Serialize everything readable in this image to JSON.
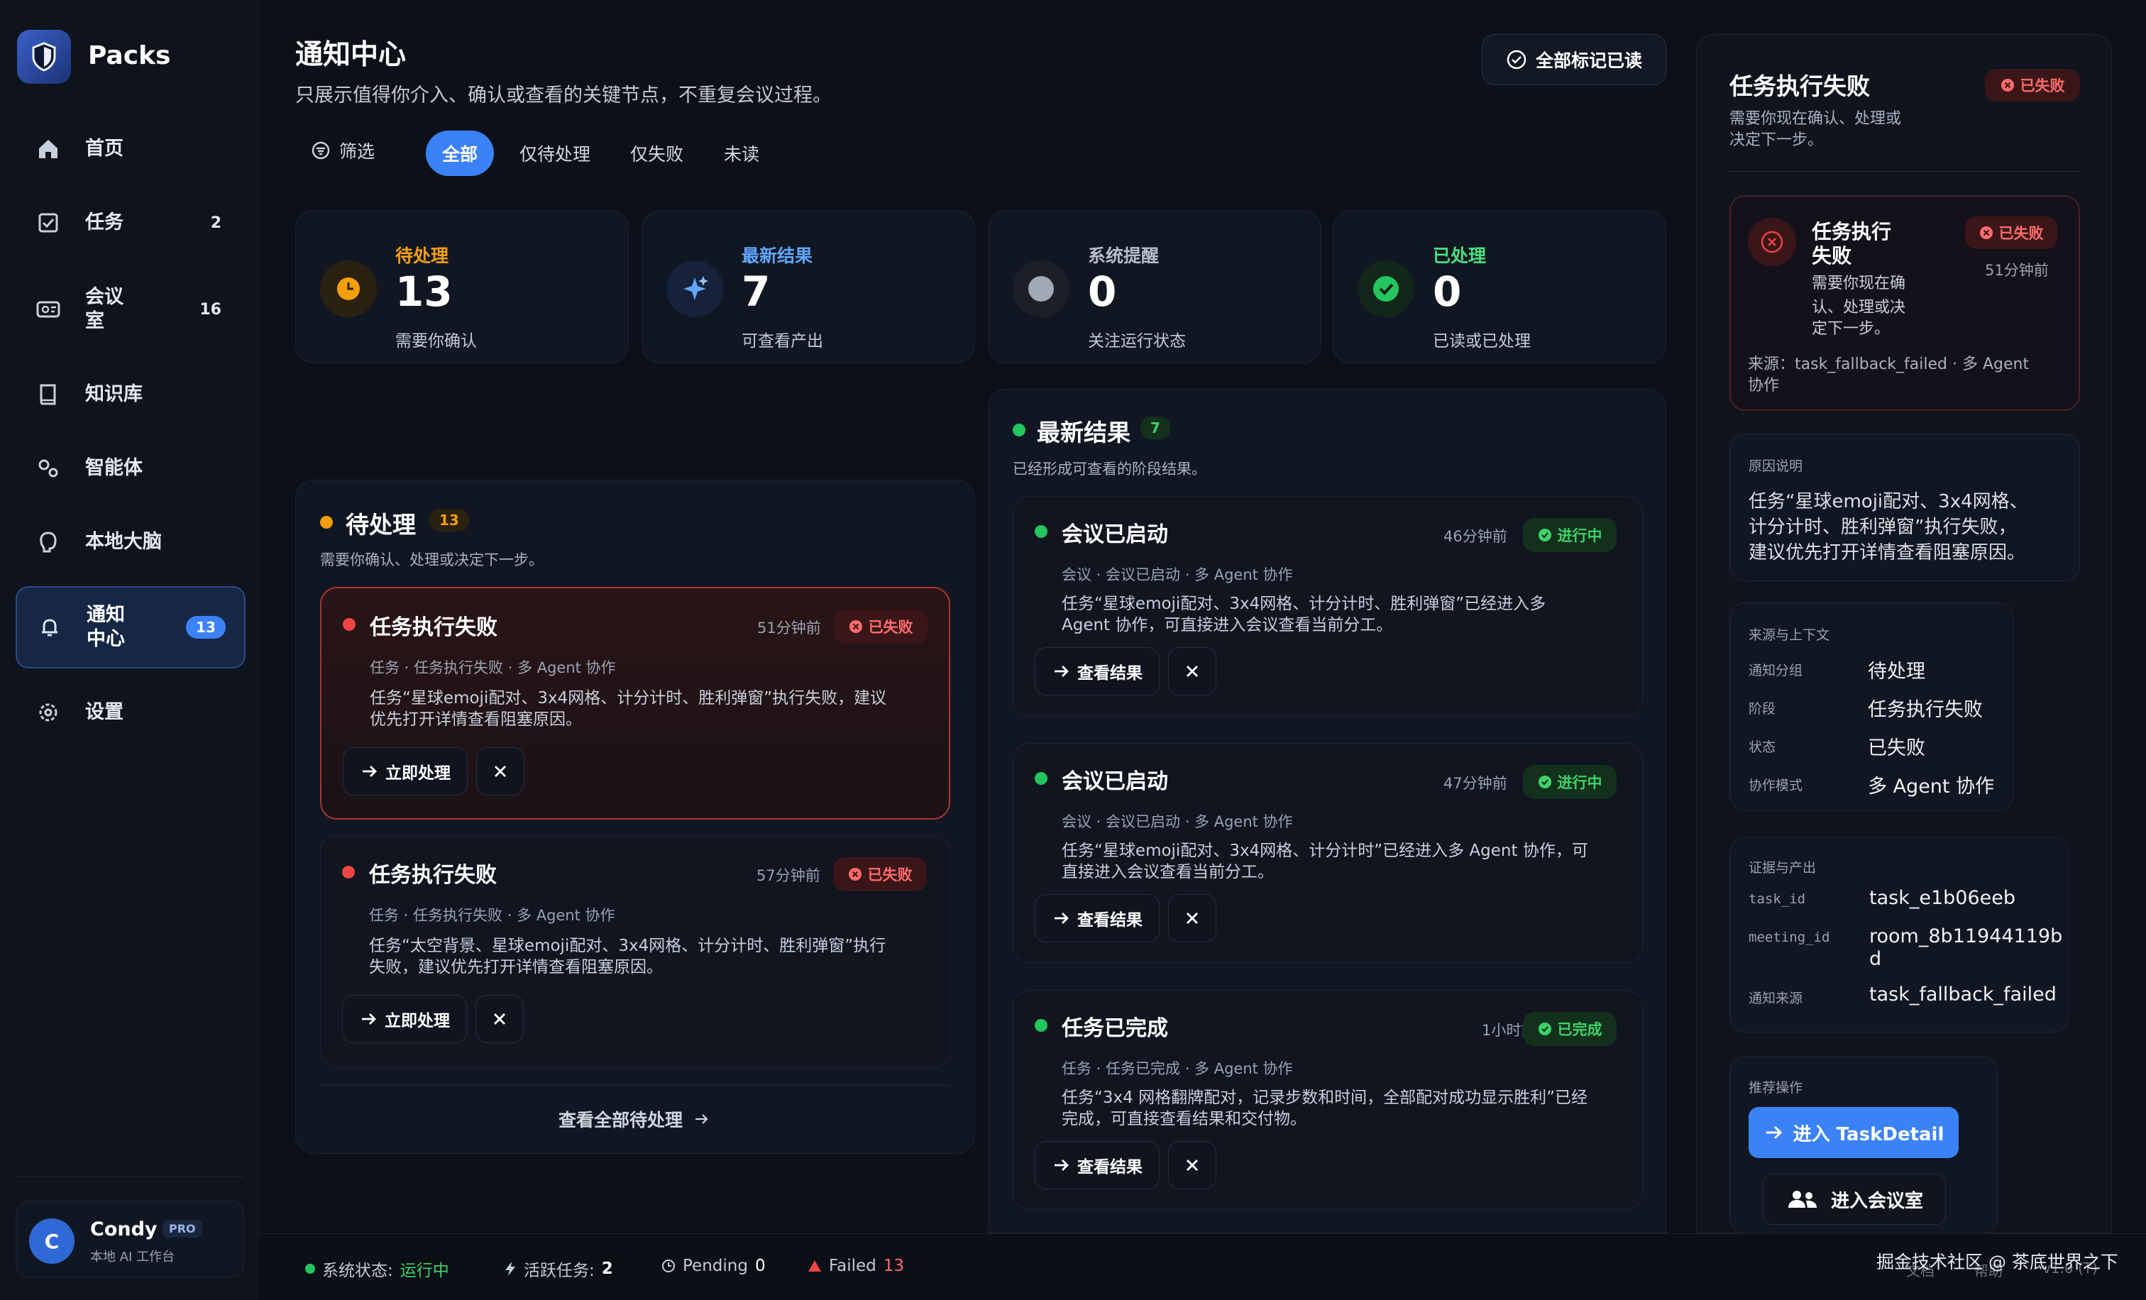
{
  "app": {
    "name": "Packs"
  },
  "sidebar": {
    "items": [
      {
        "label": "首页",
        "count": ""
      },
      {
        "label": "任务",
        "count": "2"
      },
      {
        "label": "会议\n室",
        "count": "16"
      },
      {
        "label": "知识库",
        "count": ""
      },
      {
        "label": "智能体",
        "count": ""
      },
      {
        "label": "本地大脑",
        "count": ""
      },
      {
        "label": "通知\n中心",
        "count": "13"
      },
      {
        "label": "设置",
        "count": ""
      }
    ],
    "user": {
      "initial": "C",
      "name": "Condy",
      "plan": "PRO",
      "subtitle": "本地 AI 工作台"
    }
  },
  "header": {
    "title": "通知中心",
    "subtitle": "只展示值得你介入、确认或查看的关键节点，不重复会议过程。",
    "mark_all_read": "全部标记已读"
  },
  "filters": {
    "filter_label": "筛选",
    "tabs": [
      "全部",
      "仅待处理",
      "仅失败",
      "未读"
    ],
    "active": "全部"
  },
  "stats": [
    {
      "title": "待处理",
      "value": "13",
      "sub": "需要你确认",
      "color": "#f59e0b"
    },
    {
      "title": "最新结果",
      "value": "7",
      "sub": "可查看产出",
      "color": "#60a5fa"
    },
    {
      "title": "系统提醒",
      "value": "0",
      "sub": "关注运行状态",
      "color": "#b6bcc8"
    },
    {
      "title": "已处理",
      "value": "0",
      "sub": "已读或已处理",
      "color": "#4ade80"
    }
  ],
  "pending": {
    "title": "待处理",
    "count": "13",
    "subtitle": "需要你确认、处理或决定下一步。",
    "items": [
      {
        "title": "任务执行失败",
        "time": "51分钟前",
        "badge": "已失败",
        "meta": "任务 · 任务执行失败 · 多 Agent 协作",
        "desc_l1": "任务“星球emoji配对、3x4网格、计分计时、胜利弹窗”执行失败，建议",
        "desc_l2": "优先打开详情查看阻塞原因。",
        "action": "立即处理"
      },
      {
        "title": "任务执行失败",
        "time": "57分钟前",
        "badge": "已失败",
        "meta": "任务 · 任务执行失败 · 多 Agent 协作",
        "desc_l1": "任务“太空背景、星球emoji配对、3x4网格、计分计时、胜利弹窗”执行",
        "desc_l2": "失败，建议优先打开详情查看阻塞原因。",
        "action": "立即处理"
      }
    ],
    "view_all": "查看全部待处理"
  },
  "results": {
    "title": "最新结果",
    "count": "7",
    "subtitle": "已经形成可查看的阶段结果。",
    "items": [
      {
        "title": "会议已启动",
        "time": "46分钟前",
        "badge": "进行中",
        "meta": "会议 · 会议已启动 · 多 Agent 协作",
        "desc_l1": "任务“星球emoji配对、3x4网格、计分计时、胜利弹窗”已经进入多",
        "desc_l2": "Agent 协作，可直接进入会议查看当前分工。",
        "action": "查看结果"
      },
      {
        "title": "会议已启动",
        "time": "47分钟前",
        "badge": "进行中",
        "meta": "会议 · 会议已启动 · 多 Agent 协作",
        "desc_l1": "任务“星球emoji配对、3x4网格、计分计时”已经进入多 Agent 协作，可",
        "desc_l2": "直接进入会议查看当前分工。",
        "action": "查看结果"
      },
      {
        "title": "任务已完成",
        "time": "1小时前",
        "badge": "已完成",
        "meta": "任务 · 任务已完成 · 多 Agent 协作",
        "desc_l1": "任务“3x4 网格翻牌配对，记录步数和时间，全部配对成功显示胜利”已经",
        "desc_l2": "完成，可直接查看结果和交付物。",
        "action": "查看结果"
      }
    ]
  },
  "detail": {
    "title": "任务执行失败",
    "badge": "已失败",
    "subtitle_l1": "需要你现在确认、处理或",
    "subtitle_l2": "决定下一步。",
    "card": {
      "title_l1": "任务执行",
      "title_l2": "失败",
      "badge": "已失败",
      "time": "51分钟前",
      "desc_l1": "需要你现在确",
      "desc_l2": "认、处理或决",
      "desc_l3": "定下一步。",
      "source_l1": "来源：task_fallback_failed · 多 Agent",
      "source_l2": "协作"
    },
    "reason": {
      "label": "原因说明",
      "l1": "任务“星球emoji配对、3x4网格、",
      "l2": "计分计时、胜利弹窗”执行失败，",
      "l3": "建议优先打开详情查看阻塞原因。"
    },
    "context": {
      "label": "来源与上下文",
      "rows": [
        {
          "k": "通知分组",
          "v": "待处理"
        },
        {
          "k": "阶段",
          "v": "任务执行失败"
        },
        {
          "k": "状态",
          "v": "已失败"
        },
        {
          "k": "协作模式",
          "v": "多 Agent 协作"
        }
      ]
    },
    "evidence": {
      "label": "证据与产出",
      "task_id_key": "task_id",
      "task_id": "task_e1b06eeb",
      "meeting_id_key": "meeting_id",
      "meeting_id_l1": "room_8b11944119b",
      "meeting_id_l2": "d",
      "source_key": "通知来源",
      "source": "task_fallback_failed"
    },
    "actions": {
      "label": "推荐操作",
      "primary": "进入 TaskDetail",
      "secondary": "进入会议室"
    }
  },
  "status_bar": {
    "system_label": "系统状态:",
    "system_value": "运行中",
    "active_label": "活跃任务:",
    "active_value": "2",
    "pending_label": "Pending",
    "pending_value": "0",
    "failed_label": "Failed",
    "failed_value": "13",
    "links": [
      "文档",
      "帮助",
      "v1.0 (T)"
    ],
    "watermark": "掘金技术社区 @ 茶底世界之下"
  },
  "colors": {
    "accent": "#3b82f6",
    "fail": "#ef4444",
    "success": "#22c55e",
    "warn": "#f59e0b"
  }
}
